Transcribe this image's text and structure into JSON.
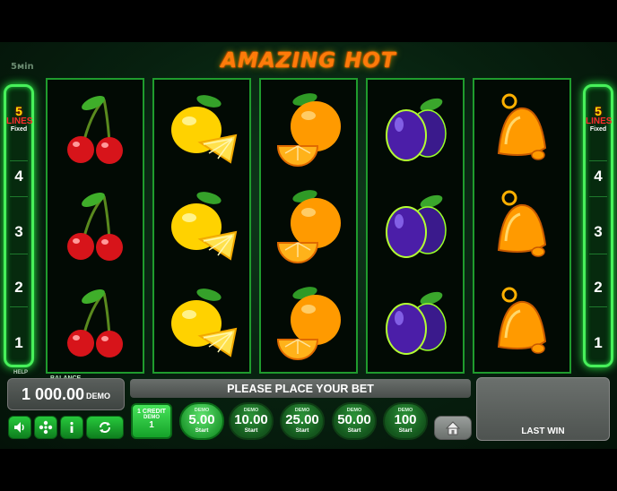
{
  "header": {
    "brand_mark": "5мin",
    "title": "AMAZING HOT"
  },
  "paylines": {
    "count": "5",
    "lines_label": "LINES",
    "fixed_label": "Fixed",
    "left_numbers": [
      "4",
      "3",
      "2",
      "1"
    ],
    "right_numbers": [
      "4",
      "3",
      "2",
      "1"
    ]
  },
  "reels": [
    {
      "symbols": [
        "cherry-icon",
        "cherry-icon",
        "cherry-icon"
      ]
    },
    {
      "symbols": [
        "lemon-icon",
        "lemon-icon",
        "lemon-icon"
      ]
    },
    {
      "symbols": [
        "orange-icon",
        "orange-icon",
        "orange-icon"
      ]
    },
    {
      "symbols": [
        "plum-icon",
        "plum-icon",
        "plum-icon"
      ]
    },
    {
      "symbols": [
        "bell-icon",
        "bell-icon",
        "bell-icon"
      ]
    }
  ],
  "help_label": "HELP",
  "balance": {
    "label": "BALANCE",
    "value": "1 000.00",
    "currency": "DEMO"
  },
  "message": "PLEASE PLACE YOUR BET",
  "credit": {
    "line1": "1 CREDIT",
    "line2": "DEMO",
    "value": "1"
  },
  "bets": [
    {
      "demo": "DEMO",
      "value": "5.00",
      "start": "Start",
      "active": true
    },
    {
      "demo": "DEMO",
      "value": "10.00",
      "start": "Start",
      "active": false
    },
    {
      "demo": "DEMO",
      "value": "25.00",
      "start": "Start",
      "active": false
    },
    {
      "demo": "DEMO",
      "value": "50.00",
      "start": "Start",
      "active": false
    },
    {
      "demo": "DEMO",
      "value": "100",
      "start": "Start",
      "active": false
    }
  ],
  "last_win": {
    "label": "LAST WIN"
  },
  "controls": [
    "sound-icon",
    "settings-icon",
    "info-icon",
    "autoplay-icon",
    "home-icon"
  ],
  "colors": {
    "accent_green": "#47f05a",
    "title_orange": "#ff7a0a",
    "lines_yellow": "#ffe100",
    "lines_red": "#ff2d2d"
  }
}
